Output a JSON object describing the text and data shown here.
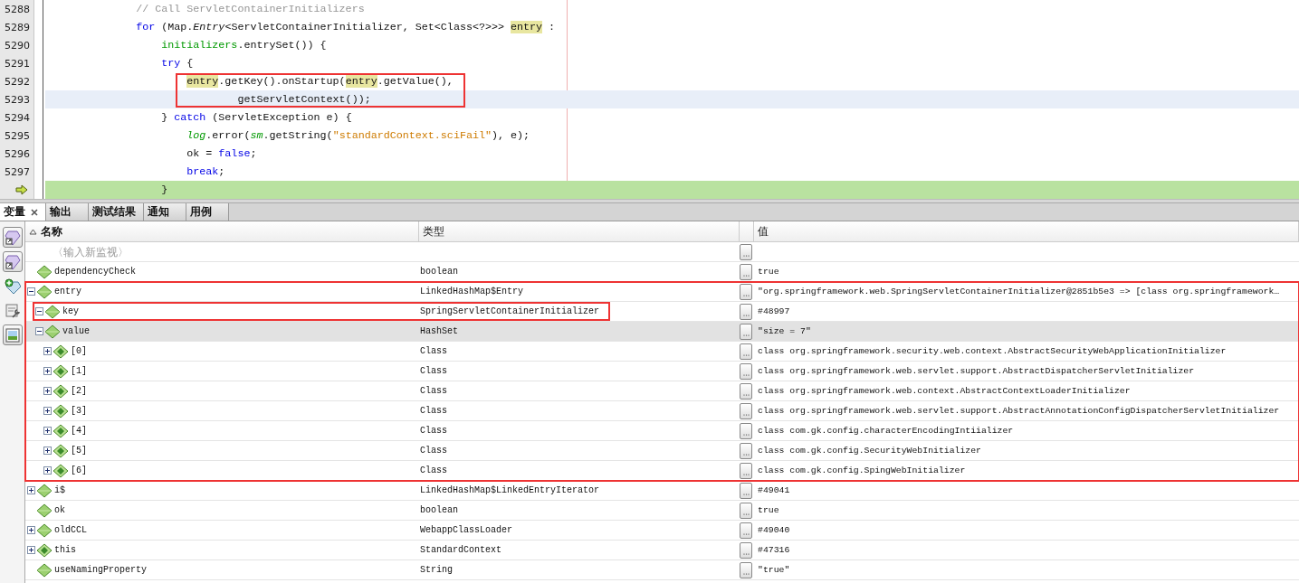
{
  "editor": {
    "lines": [
      {
        "number": "5288",
        "caret_line": false,
        "current_line": false,
        "boxed": false,
        "tokens": [
          {
            "kind": "comment",
            "text": "            // Call ServletContainerInitializers"
          }
        ]
      },
      {
        "number": "5289",
        "caret_line": false,
        "current_line": false,
        "boxed": false,
        "tokens": [
          {
            "kind": "keyword",
            "text": "            for"
          },
          {
            "kind": "plain",
            "text": " (Map."
          },
          {
            "kind": "italic",
            "text": "Entry"
          },
          {
            "kind": "plain",
            "text": "<ServletContainerInitializer, Set<Class<?>>> "
          },
          {
            "kind": "occurrence",
            "text": "entry"
          },
          {
            "kind": "plain",
            "text": " :"
          }
        ]
      },
      {
        "number": "5290",
        "caret_line": false,
        "current_line": false,
        "boxed": false,
        "tokens": [
          {
            "kind": "field",
            "text": "                initializers"
          },
          {
            "kind": "plain",
            "text": ".entrySet()) {"
          }
        ]
      },
      {
        "number": "5291",
        "caret_line": false,
        "current_line": false,
        "boxed": false,
        "tokens": [
          {
            "kind": "keyword",
            "text": "                try"
          },
          {
            "kind": "plain",
            "text": " {"
          }
        ]
      },
      {
        "number": "5292",
        "caret_line": false,
        "current_line": false,
        "boxed": true,
        "tokens": [
          {
            "kind": "occurrence",
            "text": "                    entry"
          },
          {
            "kind": "plain",
            "text": ".getKey().onStartup("
          },
          {
            "kind": "occurrence",
            "text": "entry"
          },
          {
            "kind": "plain",
            "text": ".getValue(),"
          }
        ]
      },
      {
        "number": "5293",
        "caret_line": true,
        "current_line": false,
        "boxed": true,
        "tokens": [
          {
            "kind": "plain",
            "text": "                            getServletContext());"
          }
        ]
      },
      {
        "number": "5294",
        "caret_line": false,
        "current_line": false,
        "boxed": false,
        "tokens": [
          {
            "kind": "plain",
            "text": "                } "
          },
          {
            "kind": "keyword",
            "text": "catch"
          },
          {
            "kind": "plain",
            "text": " (ServletException e) {"
          }
        ]
      },
      {
        "number": "5295",
        "caret_line": false,
        "current_line": false,
        "boxed": false,
        "tokens": [
          {
            "kind": "static",
            "text": "                    log"
          },
          {
            "kind": "plain",
            "text": ".error("
          },
          {
            "kind": "static",
            "text": "sm"
          },
          {
            "kind": "plain",
            "text": ".getString("
          },
          {
            "kind": "string",
            "text": "\"standardContext.sciFail\""
          },
          {
            "kind": "plain",
            "text": "), e);"
          }
        ]
      },
      {
        "number": "5296",
        "caret_line": false,
        "current_line": false,
        "boxed": false,
        "tokens": [
          {
            "kind": "plain",
            "text": "                    ok = "
          },
          {
            "kind": "keyword",
            "text": "false"
          },
          {
            "kind": "plain",
            "text": ";"
          }
        ]
      },
      {
        "number": "5297",
        "caret_line": false,
        "current_line": false,
        "boxed": false,
        "tokens": [
          {
            "kind": "keyword",
            "text": "                    break"
          },
          {
            "kind": "plain",
            "text": ";"
          }
        ]
      },
      {
        "caret_line": false,
        "current_line": true,
        "boxed": false,
        "tokens": [
          {
            "kind": "plain",
            "text": "                }"
          }
        ]
      }
    ]
  },
  "tabs": [
    {
      "label": "变量",
      "selected": true,
      "closable": true
    },
    {
      "label": "输出",
      "selected": false,
      "closable": false
    },
    {
      "label": "测试结果",
      "selected": false,
      "closable": false
    },
    {
      "label": "通知",
      "selected": false,
      "closable": false
    },
    {
      "label": "用例",
      "selected": false,
      "closable": false
    }
  ],
  "toolbar": [
    {
      "kind": "gem-arrow",
      "on": true
    },
    {
      "kind": "gem-arrow",
      "on": true
    },
    {
      "kind": "gem-plus",
      "on": false
    },
    {
      "kind": "wrench",
      "on": false
    },
    {
      "kind": "picture",
      "on": true
    }
  ],
  "variables": {
    "columns": [
      "名称",
      "类型",
      "值"
    ],
    "new_watch": {
      "placeholder": "〈输入新监视〉"
    },
    "rows": [
      {
        "name": "dependencyCheck",
        "type": "boolean",
        "value": "true",
        "kind": "variable",
        "expandable": false,
        "selected": false,
        "annotated": false
      },
      {
        "name": "entry",
        "type": "LinkedHashMap$Entry",
        "value": "\"org.springframework.web.SpringServletContainerInitializer@2851b5e3 => [class org.springframework…",
        "kind": "variable",
        "expandable": true,
        "expanded": true,
        "selected": false,
        "annotated": true,
        "children": [
          {
            "name": "key",
            "type": "SpringServletContainerInitializer",
            "value": "#48997",
            "kind": "variable",
            "expandable": true,
            "expanded": true,
            "selected": false,
            "annotated": true
          },
          {
            "name": "value",
            "type": "HashSet",
            "value": "\"size = 7\"",
            "kind": "variable",
            "expandable": true,
            "expanded": true,
            "selected": true,
            "annotated": false,
            "children": [
              {
                "name": "[0]",
                "type": "Class",
                "value": "class org.springframework.security.web.context.AbstractSecurityWebApplicationInitializer",
                "kind": "element",
                "expandable": true,
                "expanded": false,
                "selected": false,
                "annotated": false
              },
              {
                "name": "[1]",
                "type": "Class",
                "value": "class org.springframework.web.servlet.support.AbstractDispatcherServletInitializer",
                "kind": "element",
                "expandable": true,
                "expanded": false,
                "selected": false,
                "annotated": false
              },
              {
                "name": "[2]",
                "type": "Class",
                "value": "class org.springframework.web.context.AbstractContextLoaderInitializer",
                "kind": "element",
                "expandable": true,
                "expanded": false,
                "selected": false,
                "annotated": false
              },
              {
                "name": "[3]",
                "type": "Class",
                "value": "class org.springframework.web.servlet.support.AbstractAnnotationConfigDispatcherServletInitializer",
                "kind": "element",
                "expandable": true,
                "expanded": false,
                "selected": false,
                "annotated": false
              },
              {
                "name": "[4]",
                "type": "Class",
                "value": "class com.gk.config.characterEncodingIntiializer",
                "kind": "element",
                "expandable": true,
                "expanded": false,
                "selected": false,
                "annotated": false
              },
              {
                "name": "[5]",
                "type": "Class",
                "value": "class com.gk.config.SecurityWebInitializer",
                "kind": "element",
                "expandable": true,
                "expanded": false,
                "selected": false,
                "annotated": false
              },
              {
                "name": "[6]",
                "type": "Class",
                "value": "class com.gk.config.SpingWebInitializer",
                "kind": "element",
                "expandable": true,
                "expanded": false,
                "selected": false,
                "annotated": false
              }
            ]
          }
        ]
      },
      {
        "name": "i$",
        "type": "LinkedHashMap$LinkedEntryIterator",
        "value": "#49041",
        "kind": "variable",
        "expandable": true,
        "expanded": false,
        "selected": false,
        "annotated": false
      },
      {
        "name": "ok",
        "type": "boolean",
        "value": "true",
        "kind": "variable",
        "expandable": false,
        "selected": false,
        "annotated": false
      },
      {
        "name": "oldCCL",
        "type": "WebappClassLoader",
        "value": "#49040",
        "kind": "variable",
        "expandable": true,
        "expanded": false,
        "selected": false,
        "annotated": false
      },
      {
        "name": "this",
        "type": "StandardContext",
        "value": "#47316",
        "kind": "element",
        "expandable": true,
        "expanded": false,
        "selected": false,
        "annotated": false
      },
      {
        "name": "useNamingProperty",
        "type": "String",
        "value": "\"true\"",
        "kind": "variable",
        "expandable": false,
        "selected": false,
        "annotated": false
      }
    ]
  }
}
